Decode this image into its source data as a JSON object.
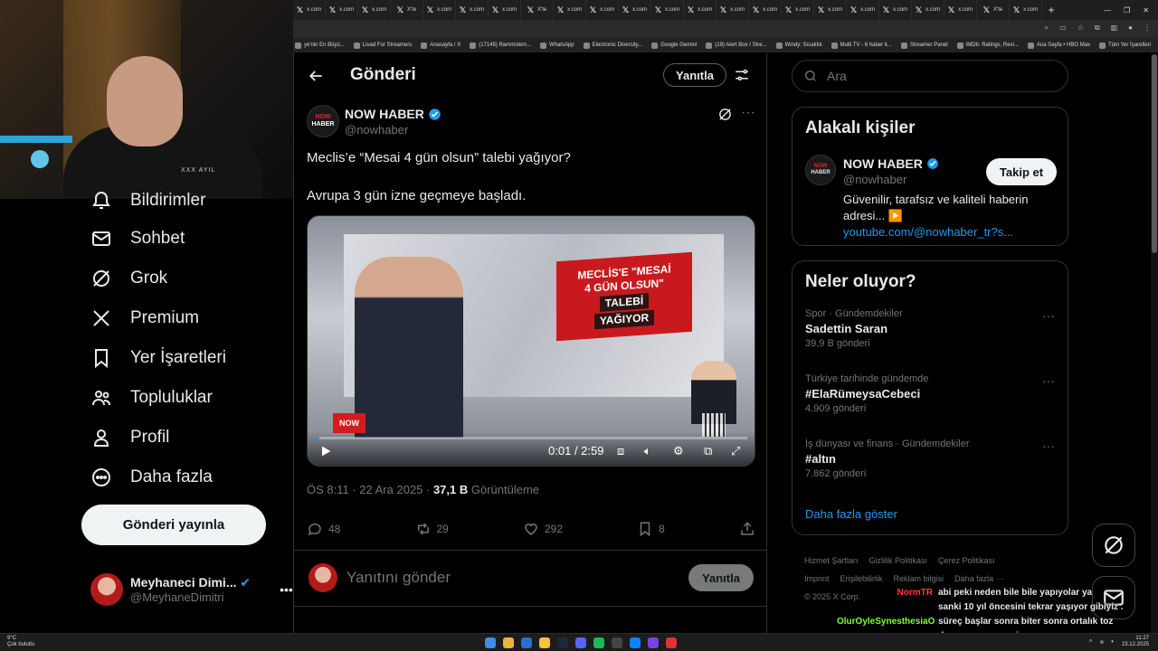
{
  "browser": {
    "tabs": [
      "x.com",
      "x.com",
      "x.com",
      "X'te",
      "x.com",
      "x.com",
      "x.com",
      "X'te",
      "x.com",
      "x.com",
      "x.com",
      "x.com",
      "x.com",
      "x.com",
      "x.com",
      "x.com",
      "x.com",
      "x.com",
      "x.com",
      "x.com",
      "x.com",
      "X'te",
      "x.com"
    ],
    "bookmarks": [
      "ye'nin En Büyü...",
      "Livad For Streamers",
      "Anasayfa / X",
      "(17145) Rammstein...",
      "WhatsApp",
      "Electronic Diversity...",
      "Google Gemini",
      "(19) Alert Box / Stre...",
      "Windy: Sıcaklık",
      "Multi TV - 6 haber k...",
      "Streamer Panel",
      "IMDb: Ratings, Revi...",
      "Ana Sayfa • HBO Max",
      "Tüm Yer İşaretleri"
    ]
  },
  "webcam": {
    "logo_text": "XXX AYIL"
  },
  "nav": {
    "items": [
      {
        "label": "Bildirimler",
        "icon": "bell-icon"
      },
      {
        "label": "Sohbet",
        "icon": "mail-icon"
      },
      {
        "label": "Grok",
        "icon": "grok-icon"
      },
      {
        "label": "Premium",
        "icon": "x-logo-icon"
      },
      {
        "label": "Yer İşaretleri",
        "icon": "bookmark-icon"
      },
      {
        "label": "Topluluklar",
        "icon": "communities-icon"
      },
      {
        "label": "Profil",
        "icon": "profile-icon"
      },
      {
        "label": "Daha fazla",
        "icon": "more-circle-icon"
      }
    ],
    "post_button": "Gönderi yayınla",
    "profile": {
      "name": "Meyhaneci Dimi...",
      "handle": "@MeyhaneDimitri",
      "more": "•••"
    }
  },
  "main": {
    "title": "Gönderi",
    "reply_pill": "Yanıtla",
    "author": {
      "name": "NOW HABER",
      "handle": "@nowhaber",
      "avatar_top": "NOW",
      "avatar_bottom": "HABER"
    },
    "text_line1": "Meclis’e “Mesai 4 gün olsun” talebi yağıyor?",
    "text_line2": "Avrupa 3 gün izne geçmeye başladı.",
    "video": {
      "banner_line1": "MECLİS'E \"MESAİ",
      "banner_line2": "4 GÜN OLSUN\"",
      "banner_line3": "TALEBİ",
      "banner_line4": "YAĞIYOR",
      "channel_logo": "NOW",
      "time": "0:01 / 2:59",
      "progress": 0.006
    },
    "meta": {
      "time": "ÖS 8:11 · 22 Ara 2025 · ",
      "views": "37,1 B",
      "views_label": " Görüntüleme"
    },
    "actions": {
      "replies": "48",
      "reposts": "29",
      "likes": "292",
      "bookmarks": "8"
    },
    "reply": {
      "placeholder": "Yanıtını gönder",
      "button": "Yanıtla"
    }
  },
  "right": {
    "search_placeholder": "Ara",
    "related": {
      "title": "Alakalı kişiler",
      "name": "NOW HABER",
      "handle": "@nowhaber",
      "follow": "Takip et",
      "bio": "Güvenilir, tarafsız ve kaliteli haberin adresi... ▶️",
      "link": "youtube.com/@nowhaber_tr?s..."
    },
    "trends": {
      "title": "Neler oluyor?",
      "items": [
        {
          "category": "Spor · Gündemdekiler",
          "name": "Sadettin Saran",
          "count": "39,9 B gönderi"
        },
        {
          "category": "Türkiye tarihinde gündemde",
          "name": "#ElaRümeysaCebeci",
          "count": "4.909 gönderi"
        },
        {
          "category": "İş dünyası ve finans · Gündemdekiler",
          "name": "#altın",
          "count": "7.862 gönderi"
        }
      ],
      "show_more": "Daha fazla göster"
    },
    "footer": [
      "Hizmet Şartları",
      "Gizlilik Politikası",
      "Çerez Politikası",
      "Imprint",
      "Erişilebilirlik",
      "Reklam bilgisi",
      "Daha fazla ···",
      "© 2025 X Corp."
    ]
  },
  "chat": [
    {
      "user": "NormTR",
      "user_color": "#ff3b3b",
      "message": "abi peki neden bile bile yapıyolar ya"
    },
    {
      "user": "",
      "user_color": "#ffffff",
      "message": "sanki 10 yıl öncesini tekrar yaşıyor gibiyiz ."
    },
    {
      "user": "OlurOyleSynesthesiaO",
      "user_color": "#7fff3a",
      "message": "süreç başlar sonra biter sonra ortalık toz"
    },
    {
      "user": "",
      "user_color": "#ffffff",
      "message": "durman sorna seçim"
    }
  ],
  "taskbar": {
    "weather_temp": "9°C",
    "weather_desc": "Çok bulutlu",
    "time": "11:27",
    "date": "23.12.2025"
  },
  "colors": {
    "accent": "#1d9bf0",
    "verified": "#1d9bf0",
    "brand_red": "#d21c21"
  }
}
